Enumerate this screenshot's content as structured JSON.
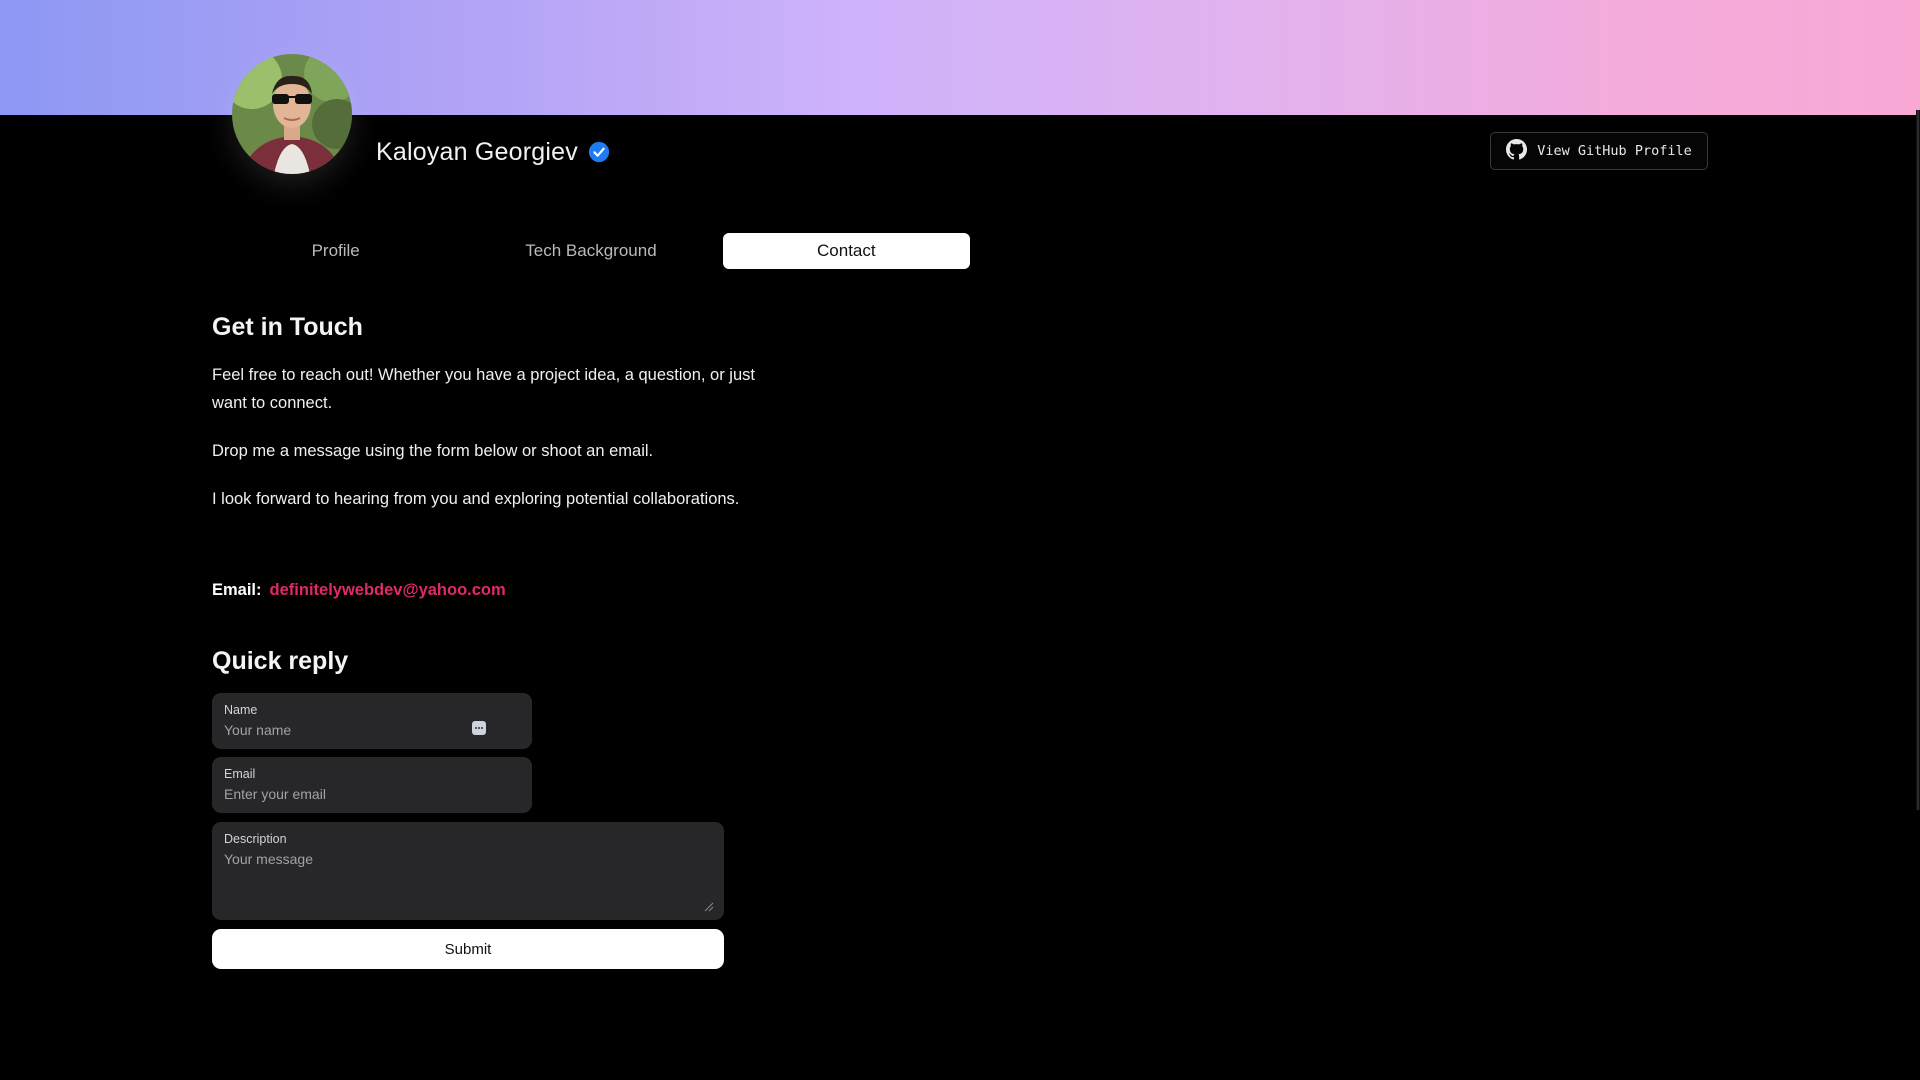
{
  "profile": {
    "name": "Kaloyan Georgiev",
    "verified_icon": "verified-badge-icon",
    "github_button": "View GitHub Profile"
  },
  "tabs": [
    {
      "label": "Profile",
      "active": false
    },
    {
      "label": "Tech Background",
      "active": false
    },
    {
      "label": "Contact",
      "active": true
    }
  ],
  "contact": {
    "heading": "Get in Touch",
    "paragraphs": [
      "Feel free to reach out! Whether you have a project idea, a question, or just want to connect.",
      "Drop me a message using the form below or shoot an email.",
      "I look forward to hearing from you and exploring potential collaborations."
    ],
    "email_label": "Email:",
    "email_value": "definitelywebdev@yahoo.com"
  },
  "quick_reply": {
    "heading": "Quick reply",
    "name_label": "Name",
    "name_placeholder": "Your name",
    "email_label": "Email",
    "email_placeholder": "Enter your email",
    "description_label": "Description",
    "description_placeholder": "Your message",
    "submit_label": "Submit"
  },
  "colors": {
    "accent_link": "#e0296b",
    "verified_blue": "#1d7cf2",
    "banner_start": "#8c98f4",
    "banner_end": "#f9a8d4"
  }
}
